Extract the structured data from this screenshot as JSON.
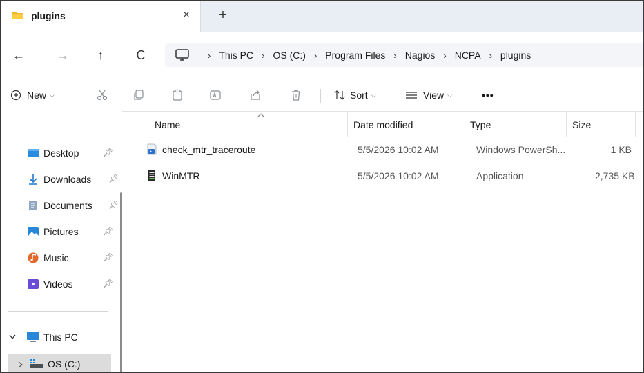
{
  "tab": {
    "title": "plugins",
    "close": "×",
    "new": "+"
  },
  "nav": {
    "back": "←",
    "forward": "→",
    "up": "↑",
    "refresh": "C"
  },
  "breadcrumb": [
    "This PC",
    "OS (C:)",
    "Program Files",
    "Nagios",
    "NCPA",
    "plugins"
  ],
  "breadcrumb_sep": "›",
  "toolbar": {
    "new_label": "New",
    "sort_label": "Sort",
    "view_label": "View",
    "more_label": "•••",
    "caret": "⌵"
  },
  "sidebar": {
    "quick_access": [
      {
        "label": "Desktop",
        "icon": "desktop-icon"
      },
      {
        "label": "Downloads",
        "icon": "downloads-icon"
      },
      {
        "label": "Documents",
        "icon": "documents-icon"
      },
      {
        "label": "Pictures",
        "icon": "pictures-icon"
      },
      {
        "label": "Music",
        "icon": "music-icon"
      },
      {
        "label": "Videos",
        "icon": "videos-icon"
      }
    ],
    "this_pc": "This PC",
    "drive": "OS (C:)"
  },
  "columns": {
    "name": "Name",
    "date": "Date modified",
    "type": "Type",
    "size": "Size"
  },
  "files": [
    {
      "name": "check_mtr_traceroute",
      "date": "5/5/2026 10:02 AM",
      "type": "Windows PowerSh...",
      "size": "1 KB",
      "icon": "powershell-script-icon"
    },
    {
      "name": "WinMTR",
      "date": "5/5/2026 10:02 AM",
      "type": "Application",
      "size": "2,735 KB",
      "icon": "application-icon"
    }
  ],
  "colors": {
    "accent": "#0067c0",
    "tabbar": "#e9eef4",
    "selected": "#dcdcdc"
  }
}
